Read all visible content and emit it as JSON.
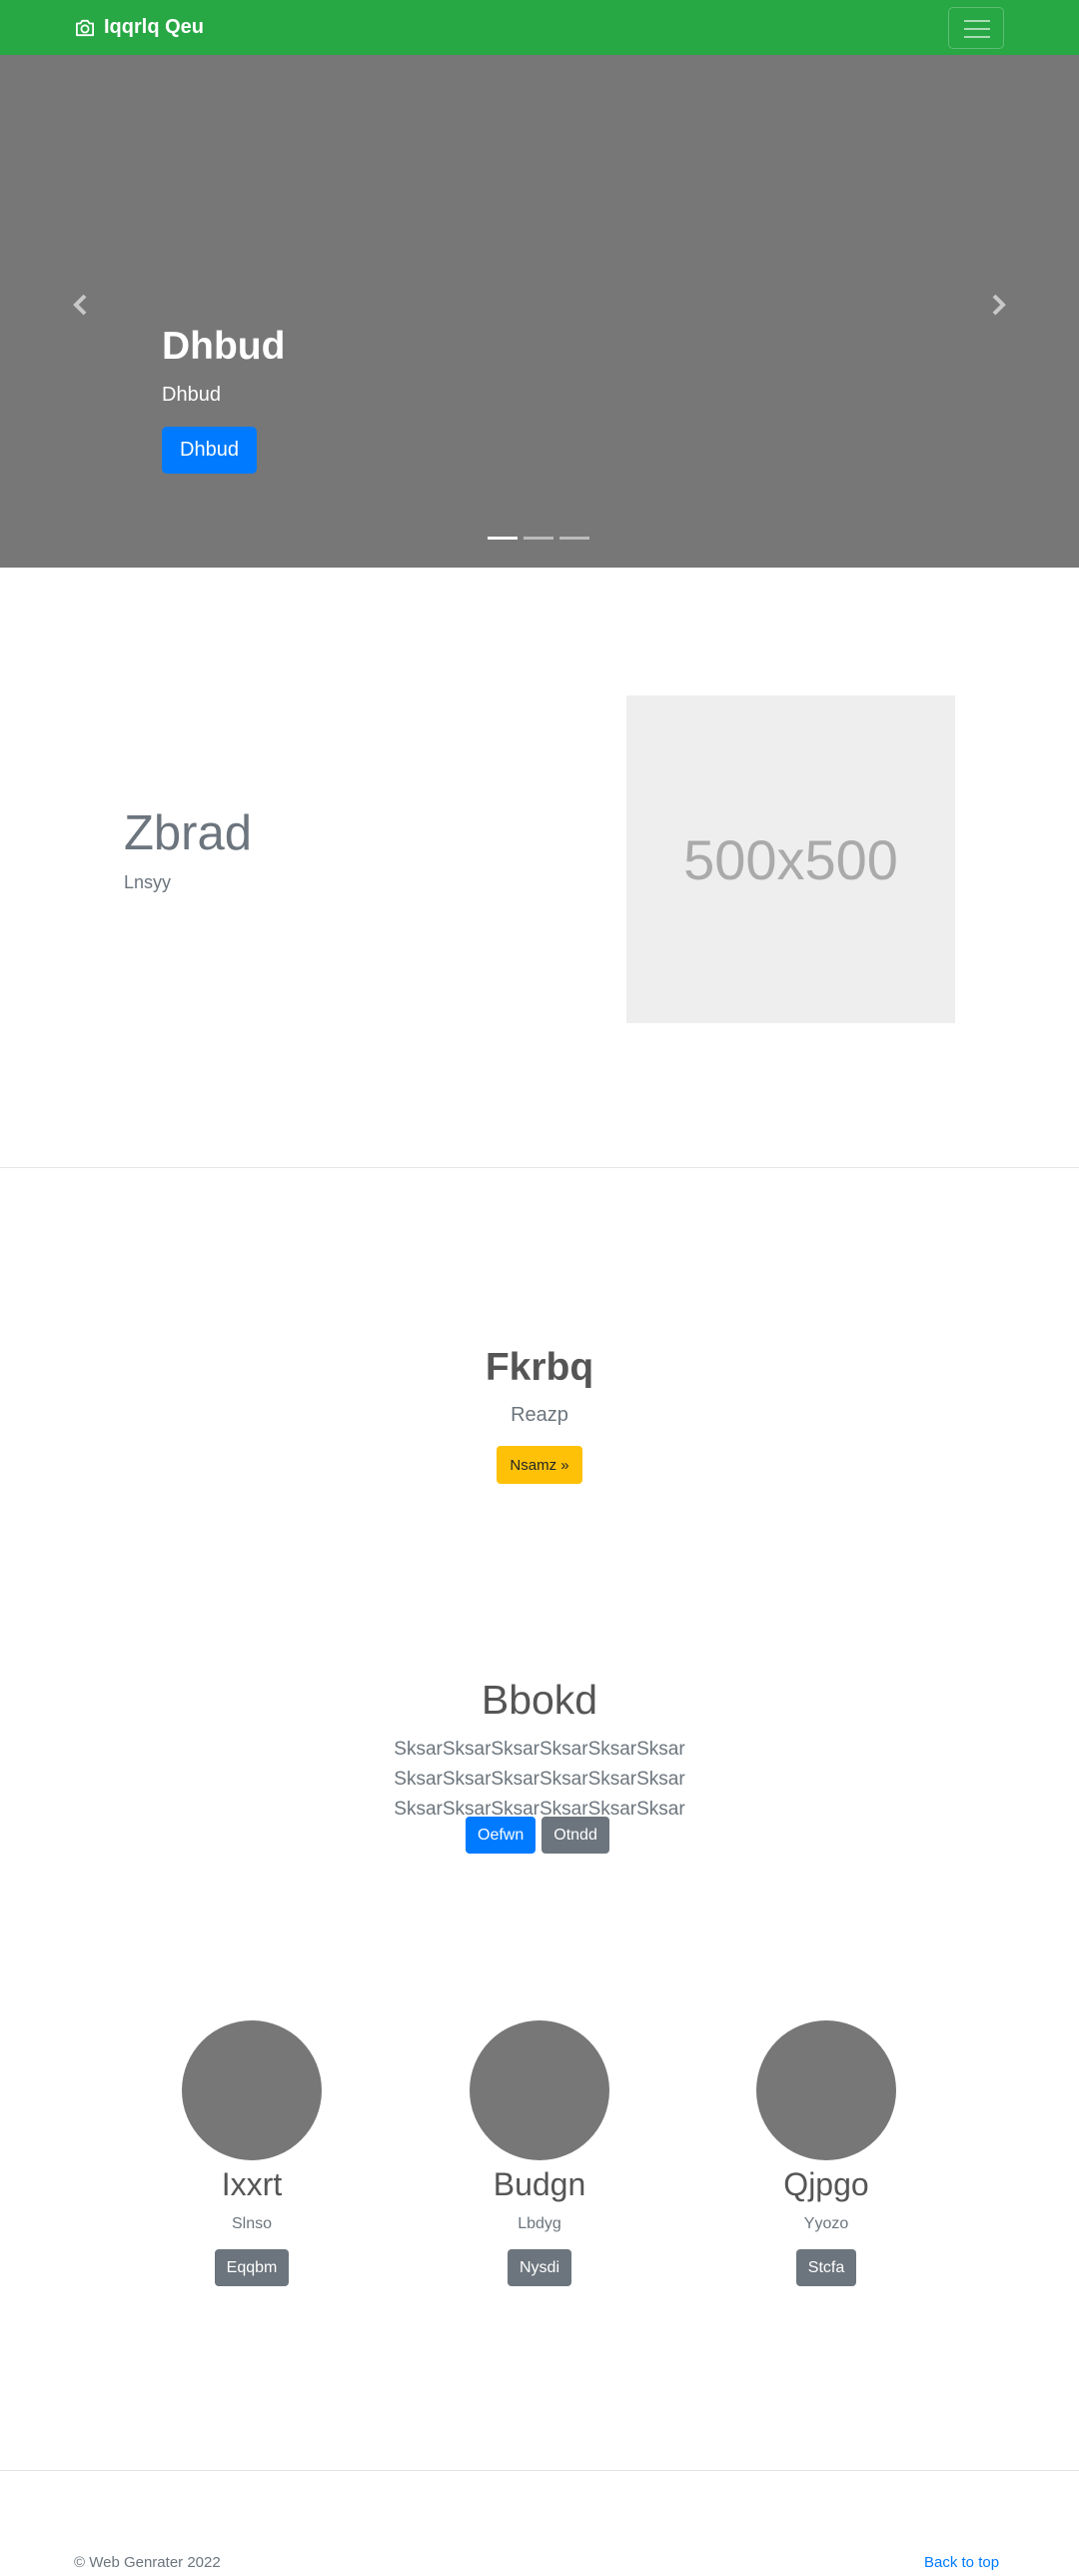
{
  "navbar": {
    "brand": "Iqqrlq Qeu",
    "brand_color": "#28a745"
  },
  "carousel": {
    "title": "Dhbud",
    "subtitle": "Dhbud",
    "button": "Dhbud",
    "slide_count": 3,
    "active_slide": 1
  },
  "featurette": {
    "heading": "Zbrad",
    "subheading": "Lnsyy",
    "image_text": "500x500"
  },
  "section1": {
    "title": "Fkrbq",
    "subtitle": "Reazp",
    "button": "Nsamz »"
  },
  "section2": {
    "title": "Bbokd",
    "text": "SksarSksarSksarSksarSksarSksar SksarSksarSksarSksarSksarSksar SksarSksarSksarSksarSksarSksar",
    "primary_button": "Oefwn",
    "secondary_button": "Otndd"
  },
  "team": [
    {
      "name": "Ixxrt",
      "role": "Slnso",
      "button": "Eqqbm"
    },
    {
      "name": "Budgn",
      "role": "Lbdyg",
      "button": "Nysdi"
    },
    {
      "name": "Qjpgo",
      "role": "Yyozo",
      "button": "Stcfa"
    }
  ],
  "footer": {
    "copyright": "© Web Genrater 2022",
    "back_to_top": "Back to top"
  }
}
